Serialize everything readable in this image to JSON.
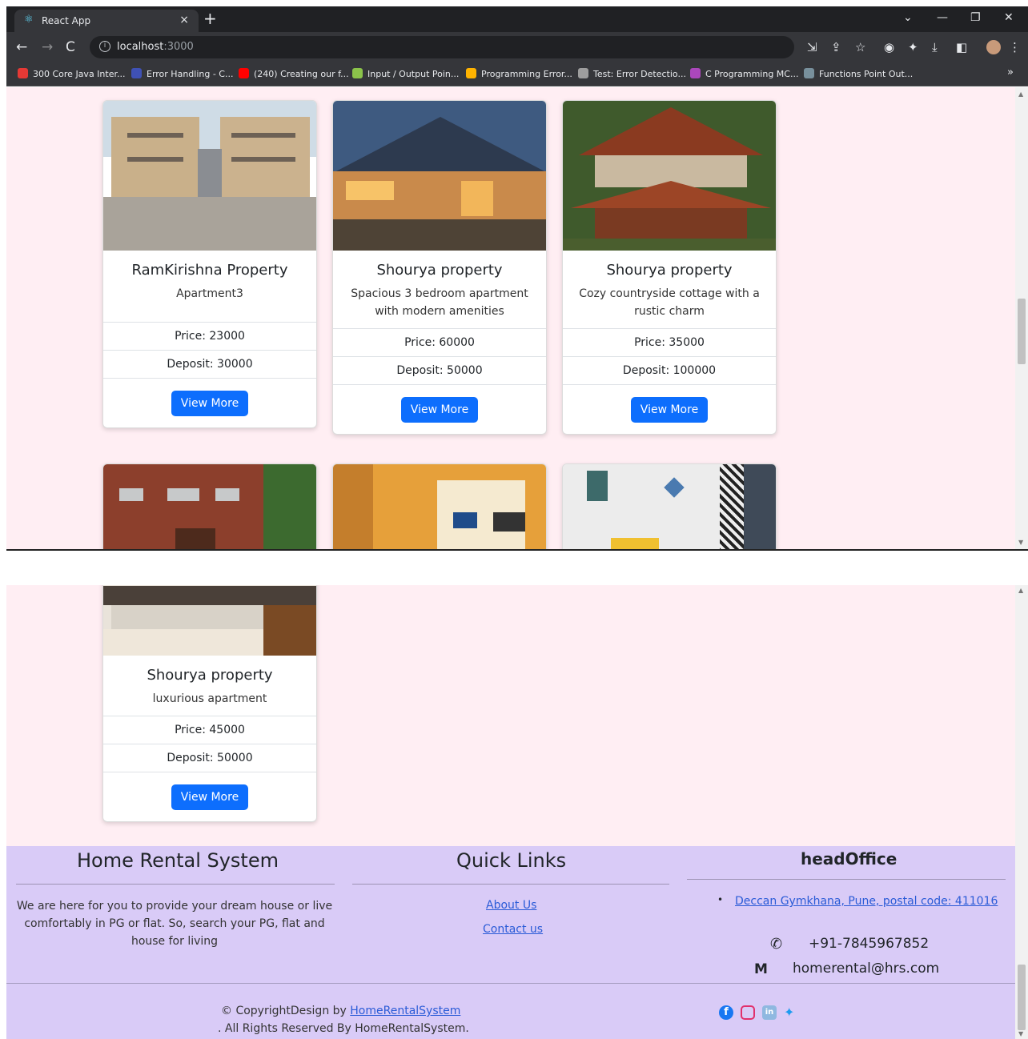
{
  "browser": {
    "tab_title": "React App",
    "tab_close": "×",
    "new_tab": "+",
    "url_host": "localhost",
    "url_port": ":3000",
    "bookmarks": [
      {
        "label": "300 Core Java Inter...",
        "color": "#e53935"
      },
      {
        "label": "Error Handling - C...",
        "color": "#3f51b5"
      },
      {
        "label": "(240) Creating our f...",
        "color": "#ff0000"
      },
      {
        "label": "Input / Output Poin...",
        "color": "#8bc34a"
      },
      {
        "label": "Programming Error...",
        "color": "#ffb300"
      },
      {
        "label": "Test: Error Detectio...",
        "color": "#9e9e9e"
      },
      {
        "label": "C Programming MC...",
        "color": "#ab47bc"
      },
      {
        "label": "Functions Point Out...",
        "color": "#78909c"
      }
    ],
    "bookmarks_more": "»"
  },
  "cards": [
    {
      "title": "RamKirishna Property",
      "desc": "Apartment3",
      "price": "Price: 23000",
      "deposit": "Deposit: 30000",
      "button": "View More"
    },
    {
      "title": "Shourya property",
      "desc": "Spacious 3 bedroom apartment with modern amenities",
      "price": "Price: 60000",
      "deposit": "Deposit: 50000",
      "button": "View More"
    },
    {
      "title": "Shourya property",
      "desc": "Cozy countryside cottage with a rustic charm",
      "price": "Price: 35000",
      "deposit": "Deposit: 100000",
      "button": "View More"
    },
    {
      "title": "Shourya property",
      "desc": "luxurious apartment",
      "price": "Price: 45000",
      "deposit": "Deposit: 50000",
      "button": "View More"
    }
  ],
  "footer": {
    "brand_title": "Home Rental System",
    "about_text": "We are here for you to provide your dream house or live comfortably in PG or flat. So, search your PG, flat and house for living",
    "quick_links_title": "Quick Links",
    "link_about": "About Us",
    "link_contact": "Contact us",
    "head_office_title": "headOffice",
    "address": "Deccan Gymkhana, Pune, postal code: 411016",
    "phone": "+91-7845967852",
    "email": "homerental@hrs.com",
    "copyright_prefix": "© CopyrightDesign by ",
    "copyright_link": "HomeRentalSystem",
    "rights": ". All Rights Reserved By HomeRentalSystem.",
    "social_icons": [
      "facebook-icon",
      "instagram-icon",
      "linkedin-icon",
      "twitter-icon"
    ]
  }
}
